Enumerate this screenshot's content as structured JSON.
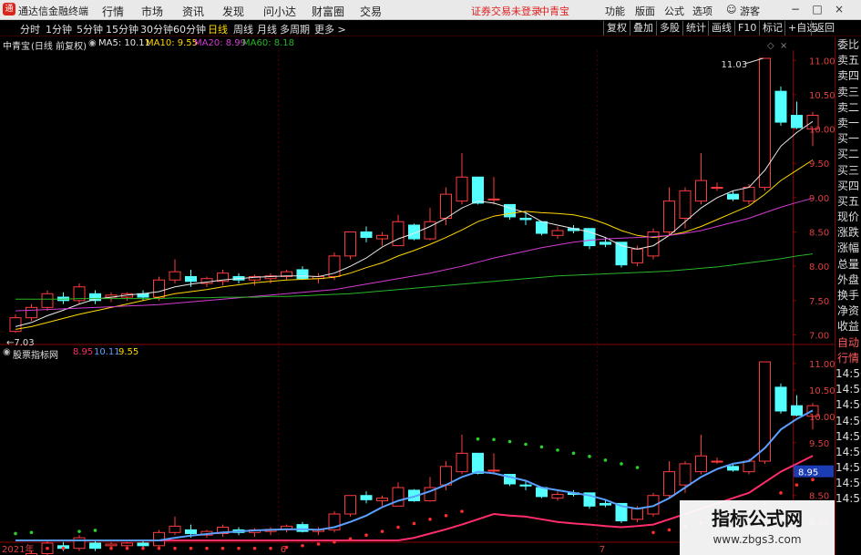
{
  "app": {
    "title": "通达信金融终端",
    "menu": [
      "行情",
      "市场",
      "资讯",
      "发现",
      "问小达",
      "财富圈",
      "交易"
    ],
    "notice": "证券交易未登录",
    "stock_link": "中青宝",
    "right_menu": [
      "功能",
      "版面",
      "公式",
      "选项",
      "游客"
    ],
    "window_buttons": [
      "−",
      "□",
      "×"
    ]
  },
  "toolbar": {
    "timeframes": [
      "分时",
      "1分钟",
      "5分钟",
      "15分钟",
      "30分钟",
      "60分钟",
      "日线",
      "周线",
      "月线",
      "多周期",
      "更多 >"
    ],
    "active_timeframe": "日线",
    "buttons": [
      "复权",
      "叠加",
      "多股",
      "统计",
      "画线",
      "F10",
      "标记",
      "+自选",
      "返回"
    ]
  },
  "main_legend": {
    "name": "中青宝",
    "mode": "(日线 前复权)",
    "ma5": "MA5: 10.11",
    "ma10": "MA10: 9.55",
    "ma20": "MA20: 8.99",
    "ma60": "MA60: 8.18"
  },
  "sub_legend": {
    "name": "股票指标网",
    "v1": "8.95",
    "v2": "10.11",
    "v3": "9.55"
  },
  "right_panel": [
    "委比",
    "卖五",
    "卖四",
    "卖三",
    "卖二",
    "卖一",
    "买一",
    "买二",
    "买三",
    "买四",
    "买五",
    "现价",
    "涨跌",
    "涨幅",
    "总量",
    "外盘",
    "换手",
    "净资",
    "收益",
    "自动",
    "行情",
    "14:56",
    "14:56",
    "14:56",
    "14:56",
    "14:56",
    "14:56",
    "14:56",
    "14:56",
    "14:56"
  ],
  "watermark": {
    "title": "指标公式网",
    "url": "www.zbgs3.com"
  },
  "chart_data": [
    {
      "type": "candlestick",
      "title": "中青宝 (日线 前复权)",
      "x_labels": [
        {
          "index": 0,
          "label": "2021年"
        },
        {
          "index": 17,
          "label": "6"
        },
        {
          "index": 37,
          "label": "7"
        }
      ],
      "ylim": [
        6.9,
        11.15
      ],
      "y_ticks": [
        7.0,
        7.5,
        8.0,
        8.5,
        9.0,
        9.5,
        10.0,
        10.5,
        11.0
      ],
      "high_marker": "11.03",
      "low_marker": "7.03",
      "candles": [
        {
          "o": 7.05,
          "h": 7.3,
          "l": 7.03,
          "c": 7.25
        },
        {
          "o": 7.25,
          "h": 7.45,
          "l": 7.2,
          "c": 7.4
        },
        {
          "o": 7.4,
          "h": 7.65,
          "l": 7.35,
          "c": 7.6
        },
        {
          "o": 7.55,
          "h": 7.62,
          "l": 7.45,
          "c": 7.5
        },
        {
          "o": 7.5,
          "h": 7.75,
          "l": 7.45,
          "c": 7.7
        },
        {
          "o": 7.6,
          "h": 7.65,
          "l": 7.45,
          "c": 7.5
        },
        {
          "o": 7.55,
          "h": 7.62,
          "l": 7.48,
          "c": 7.58
        },
        {
          "o": 7.55,
          "h": 7.62,
          "l": 7.5,
          "c": 7.6
        },
        {
          "o": 7.6,
          "h": 7.65,
          "l": 7.5,
          "c": 7.55
        },
        {
          "o": 7.55,
          "h": 7.85,
          "l": 7.5,
          "c": 7.8
        },
        {
          "o": 7.8,
          "h": 8.1,
          "l": 7.75,
          "c": 7.92
        },
        {
          "o": 7.85,
          "h": 7.95,
          "l": 7.7,
          "c": 7.78
        },
        {
          "o": 7.75,
          "h": 7.85,
          "l": 7.7,
          "c": 7.82
        },
        {
          "o": 7.78,
          "h": 7.95,
          "l": 7.72,
          "c": 7.9
        },
        {
          "o": 7.85,
          "h": 7.9,
          "l": 7.75,
          "c": 7.8
        },
        {
          "o": 7.8,
          "h": 7.88,
          "l": 7.72,
          "c": 7.85
        },
        {
          "o": 7.82,
          "h": 7.9,
          "l": 7.75,
          "c": 7.86
        },
        {
          "o": 7.85,
          "h": 7.95,
          "l": 7.8,
          "c": 7.92
        },
        {
          "o": 7.95,
          "h": 8.0,
          "l": 7.8,
          "c": 7.82
        },
        {
          "o": 7.82,
          "h": 7.9,
          "l": 7.75,
          "c": 7.85
        },
        {
          "o": 7.85,
          "h": 8.2,
          "l": 7.8,
          "c": 8.15
        },
        {
          "o": 8.15,
          "h": 8.5,
          "l": 8.1,
          "c": 8.5
        },
        {
          "o": 8.5,
          "h": 8.58,
          "l": 8.35,
          "c": 8.42
        },
        {
          "o": 8.4,
          "h": 8.5,
          "l": 8.3,
          "c": 8.45
        },
        {
          "o": 8.3,
          "h": 8.75,
          "l": 8.3,
          "c": 8.65
        },
        {
          "o": 8.6,
          "h": 8.62,
          "l": 8.38,
          "c": 8.4
        },
        {
          "o": 8.4,
          "h": 8.85,
          "l": 8.38,
          "c": 8.65
        },
        {
          "o": 8.7,
          "h": 9.15,
          "l": 8.6,
          "c": 9.05
        },
        {
          "o": 8.95,
          "h": 9.65,
          "l": 8.9,
          "c": 9.3
        },
        {
          "o": 9.3,
          "h": 9.3,
          "l": 8.9,
          "c": 8.92
        },
        {
          "o": 8.98,
          "h": 9.3,
          "l": 8.9,
          "c": 8.98
        },
        {
          "o": 8.9,
          "h": 8.9,
          "l": 8.68,
          "c": 8.72
        },
        {
          "o": 8.7,
          "h": 8.78,
          "l": 8.6,
          "c": 8.68
        },
        {
          "o": 8.65,
          "h": 8.65,
          "l": 8.45,
          "c": 8.48
        },
        {
          "o": 8.45,
          "h": 8.58,
          "l": 8.4,
          "c": 8.52
        },
        {
          "o": 8.55,
          "h": 8.6,
          "l": 8.48,
          "c": 8.52
        },
        {
          "o": 8.55,
          "h": 8.55,
          "l": 8.25,
          "c": 8.3
        },
        {
          "o": 8.35,
          "h": 8.42,
          "l": 8.28,
          "c": 8.32
        },
        {
          "o": 8.35,
          "h": 8.35,
          "l": 7.98,
          "c": 8.02
        },
        {
          "o": 8.05,
          "h": 8.3,
          "l": 8.0,
          "c": 8.25
        },
        {
          "o": 8.15,
          "h": 8.55,
          "l": 8.1,
          "c": 8.5
        },
        {
          "o": 8.5,
          "h": 9.15,
          "l": 8.45,
          "c": 8.95
        },
        {
          "o": 8.7,
          "h": 9.15,
          "l": 8.55,
          "c": 9.1
        },
        {
          "o": 8.95,
          "h": 9.65,
          "l": 8.9,
          "c": 9.25
        },
        {
          "o": 9.15,
          "h": 9.22,
          "l": 9.1,
          "c": 9.15
        },
        {
          "o": 9.05,
          "h": 9.1,
          "l": 8.95,
          "c": 8.98
        },
        {
          "o": 8.95,
          "h": 9.2,
          "l": 8.9,
          "c": 9.15
        },
        {
          "o": 9.15,
          "h": 11.03,
          "l": 9.1,
          "c": 11.03
        },
        {
          "o": 10.55,
          "h": 10.62,
          "l": 10.05,
          "c": 10.1
        },
        {
          "o": 10.2,
          "h": 10.4,
          "l": 10.0,
          "c": 10.02
        },
        {
          "o": 10.0,
          "h": 10.25,
          "l": 9.75,
          "c": 10.2
        }
      ],
      "series": [
        {
          "name": "MA5",
          "color": "#e8e8e8",
          "values": [
            7.12,
            7.18,
            7.28,
            7.36,
            7.45,
            7.52,
            7.55,
            7.58,
            7.6,
            7.63,
            7.7,
            7.74,
            7.77,
            7.8,
            7.82,
            7.84,
            7.85,
            7.86,
            7.86,
            7.85,
            7.9,
            8.0,
            8.12,
            8.28,
            8.4,
            8.48,
            8.58,
            8.7,
            8.85,
            8.95,
            8.92,
            8.85,
            8.78,
            8.65,
            8.6,
            8.55,
            8.5,
            8.42,
            8.3,
            8.25,
            8.3,
            8.45,
            8.65,
            8.85,
            9.0,
            9.1,
            9.15,
            9.4,
            9.75,
            9.95,
            10.11
          ]
        },
        {
          "name": "MA10",
          "color": "#ffd800",
          "values": [
            7.08,
            7.12,
            7.18,
            7.24,
            7.3,
            7.35,
            7.4,
            7.45,
            7.5,
            7.55,
            7.6,
            7.63,
            7.66,
            7.7,
            7.73,
            7.76,
            7.78,
            7.8,
            7.81,
            7.82,
            7.84,
            7.9,
            7.98,
            8.05,
            8.15,
            8.23,
            8.32,
            8.42,
            8.53,
            8.65,
            8.73,
            8.77,
            8.8,
            8.78,
            8.77,
            8.75,
            8.7,
            8.62,
            8.52,
            8.45,
            8.42,
            8.45,
            8.5,
            8.58,
            8.68,
            8.78,
            8.88,
            9.05,
            9.25,
            9.4,
            9.55
          ]
        },
        {
          "name": "MA20",
          "color": "#d23cd2",
          "values": [
            7.35,
            7.36,
            7.37,
            7.38,
            7.39,
            7.4,
            7.41,
            7.42,
            7.43,
            7.44,
            7.46,
            7.48,
            7.5,
            7.52,
            7.54,
            7.56,
            7.58,
            7.6,
            7.62,
            7.64,
            7.66,
            7.7,
            7.74,
            7.78,
            7.82,
            7.86,
            7.9,
            7.95,
            8.0,
            8.06,
            8.12,
            8.17,
            8.22,
            8.27,
            8.31,
            8.35,
            8.38,
            8.4,
            8.41,
            8.42,
            8.43,
            8.45,
            8.48,
            8.52,
            8.58,
            8.64,
            8.7,
            8.78,
            8.86,
            8.93,
            8.99
          ]
        },
        {
          "name": "MA60",
          "color": "#28b428",
          "values": [
            7.52,
            7.52,
            7.52,
            7.52,
            7.53,
            7.53,
            7.53,
            7.53,
            7.53,
            7.53,
            7.54,
            7.54,
            7.54,
            7.55,
            7.55,
            7.55,
            7.56,
            7.56,
            7.57,
            7.58,
            7.59,
            7.6,
            7.62,
            7.64,
            7.66,
            7.68,
            7.7,
            7.72,
            7.74,
            7.76,
            7.78,
            7.8,
            7.82,
            7.84,
            7.86,
            7.87,
            7.88,
            7.89,
            7.9,
            7.91,
            7.92,
            7.93,
            7.95,
            7.97,
            7.99,
            8.02,
            8.05,
            8.08,
            8.11,
            8.15,
            8.18
          ]
        }
      ]
    },
    {
      "type": "candlestick",
      "title": "股票指标网",
      "ylim": [
        7.65,
        11.1
      ],
      "y_ticks": [
        8.0,
        8.5,
        9.0,
        9.5,
        10.0,
        10.5,
        11.0
      ],
      "current_value_label": "8.95",
      "series": [
        {
          "name": "line1",
          "color": "#ff2d6a",
          "values": [
            6.9,
            6.92,
            6.95,
            6.98,
            7.0,
            7.02,
            7.05,
            7.08,
            7.1,
            7.13,
            7.16,
            7.18,
            7.2,
            7.22,
            7.25,
            7.27,
            7.29,
            7.31,
            7.33,
            7.35,
            7.38,
            7.42,
            7.48,
            7.55,
            7.62,
            7.7,
            7.78,
            7.86,
            7.95,
            8.05,
            8.15,
            8.12,
            8.1,
            8.05,
            8.0,
            7.97,
            7.95,
            7.92,
            7.9,
            7.92,
            7.95,
            8.05,
            8.15,
            8.25,
            8.35,
            8.45,
            8.55,
            8.75,
            8.95,
            9.1,
            9.25
          ]
        },
        {
          "name": "line2",
          "color": "#5aa0ff",
          "values": [
            7.12,
            7.18,
            7.28,
            7.36,
            7.45,
            7.52,
            7.55,
            7.58,
            7.6,
            7.63,
            7.7,
            7.74,
            7.77,
            7.8,
            7.82,
            7.84,
            7.85,
            7.86,
            7.86,
            7.85,
            7.9,
            8.0,
            8.12,
            8.28,
            8.4,
            8.48,
            8.58,
            8.7,
            8.85,
            8.95,
            8.92,
            8.85,
            8.78,
            8.65,
            8.6,
            8.55,
            8.5,
            8.42,
            8.3,
            8.25,
            8.3,
            8.45,
            8.65,
            8.85,
            9.0,
            9.1,
            9.15,
            9.4,
            9.75,
            9.95,
            10.11
          ]
        }
      ],
      "dots_green": [
        {
          "i": 0,
          "v": 7.78
        },
        {
          "i": 1,
          "v": 7.8
        },
        {
          "i": 4,
          "v": 7.82
        },
        {
          "i": 5,
          "v": 7.84
        },
        {
          "i": 29,
          "v": 9.57
        },
        {
          "i": 30,
          "v": 9.56
        },
        {
          "i": 31,
          "v": 9.52
        },
        {
          "i": 32,
          "v": 9.47
        },
        {
          "i": 33,
          "v": 9.42
        },
        {
          "i": 34,
          "v": 9.36
        },
        {
          "i": 35,
          "v": 9.3
        },
        {
          "i": 36,
          "v": 9.24
        },
        {
          "i": 37,
          "v": 9.17
        },
        {
          "i": 38,
          "v": 9.1
        },
        {
          "i": 39,
          "v": 9.03
        }
      ],
      "dots_red": [
        {
          "i": 2,
          "v": 7.2
        },
        {
          "i": 3,
          "v": 7.22
        },
        {
          "i": 6,
          "v": 7.25
        },
        {
          "i": 7,
          "v": 7.28
        },
        {
          "i": 8,
          "v": 7.3
        },
        {
          "i": 9,
          "v": 7.33
        },
        {
          "i": 10,
          "v": 7.36
        },
        {
          "i": 11,
          "v": 7.38
        },
        {
          "i": 12,
          "v": 7.4
        },
        {
          "i": 13,
          "v": 7.42
        },
        {
          "i": 14,
          "v": 7.45
        },
        {
          "i": 15,
          "v": 7.47
        },
        {
          "i": 16,
          "v": 7.5
        },
        {
          "i": 17,
          "v": 7.52
        },
        {
          "i": 18,
          "v": 7.55
        },
        {
          "i": 19,
          "v": 7.58
        },
        {
          "i": 20,
          "v": 7.62
        },
        {
          "i": 21,
          "v": 7.68
        },
        {
          "i": 22,
          "v": 7.75
        },
        {
          "i": 23,
          "v": 7.82
        },
        {
          "i": 24,
          "v": 7.9
        },
        {
          "i": 25,
          "v": 7.97
        },
        {
          "i": 26,
          "v": 8.05
        },
        {
          "i": 27,
          "v": 8.12
        },
        {
          "i": 28,
          "v": 8.2
        },
        {
          "i": 40,
          "v": 7.8
        },
        {
          "i": 41,
          "v": 7.85
        },
        {
          "i": 42,
          "v": 7.92
        },
        {
          "i": 43,
          "v": 7.98
        },
        {
          "i": 44,
          "v": 8.05
        },
        {
          "i": 45,
          "v": 8.12
        },
        {
          "i": 46,
          "v": 8.2
        },
        {
          "i": 47,
          "v": 8.35
        },
        {
          "i": 48,
          "v": 8.55
        },
        {
          "i": 49,
          "v": 8.7
        },
        {
          "i": 50,
          "v": 8.8
        }
      ]
    }
  ]
}
